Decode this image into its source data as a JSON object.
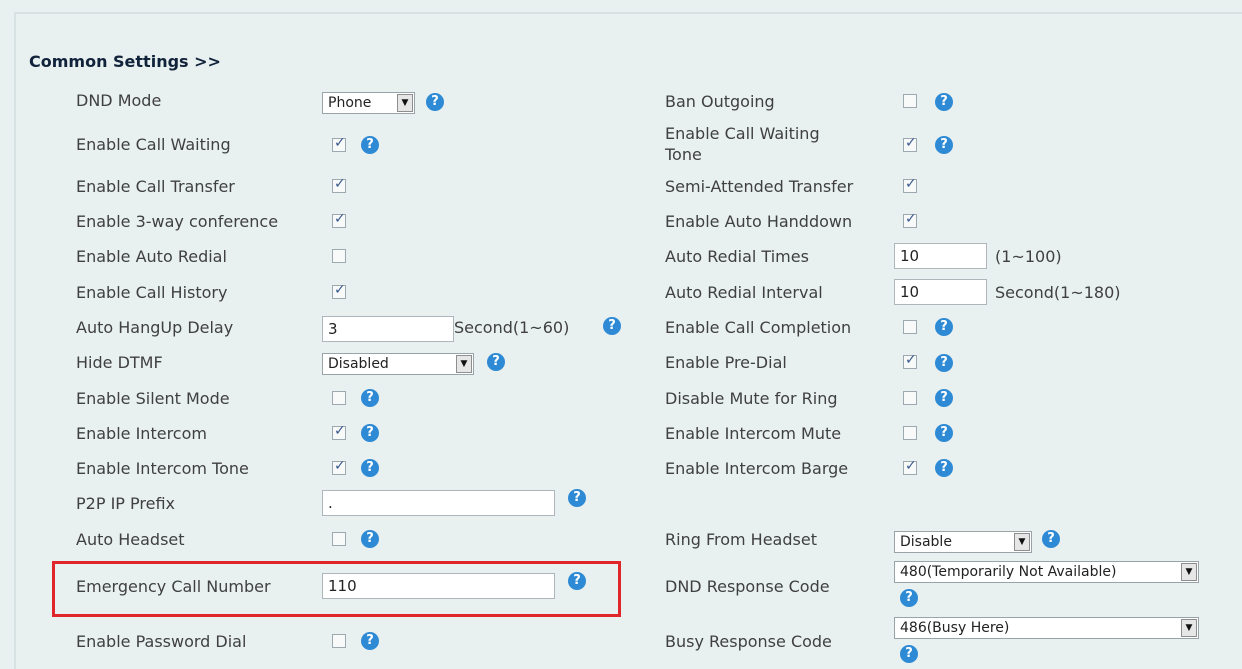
{
  "section": {
    "title": "Common Settings >>",
    "help_glyph": "?"
  },
  "select_arrow": "▼",
  "left": {
    "dnd_mode": {
      "label": "DND Mode",
      "value": "Phone"
    },
    "call_waiting": {
      "label": "Enable Call Waiting",
      "checked": true
    },
    "call_transfer": {
      "label": "Enable Call Transfer",
      "checked": true
    },
    "three_way": {
      "label": "Enable 3-way conference",
      "checked": true
    },
    "auto_redial": {
      "label": "Enable Auto Redial",
      "checked": false
    },
    "call_history": {
      "label": "Enable Call History",
      "checked": true
    },
    "auto_hangup": {
      "label": "Auto HangUp Delay",
      "value": "3",
      "unit": "Second(1~60)"
    },
    "hide_dtmf": {
      "label": "Hide DTMF",
      "value": "Disabled"
    },
    "silent_mode": {
      "label": "Enable Silent Mode",
      "checked": false
    },
    "intercom": {
      "label": "Enable Intercom",
      "checked": true
    },
    "intercom_tone": {
      "label": "Enable Intercom Tone",
      "checked": true
    },
    "p2p_prefix": {
      "label": "P2P IP Prefix",
      "value": "."
    },
    "auto_headset": {
      "label": "Auto Headset",
      "checked": false
    },
    "emergency": {
      "label": "Emergency Call Number",
      "value": "110"
    },
    "password_dial": {
      "label": "Enable Password Dial",
      "checked": false
    }
  },
  "right": {
    "ban_outgoing": {
      "label": "Ban Outgoing",
      "checked": false
    },
    "call_waiting_tone": {
      "label_line1": "Enable Call Waiting",
      "label_line2": "Tone",
      "checked": true
    },
    "semi_attended": {
      "label": "Semi-Attended Transfer",
      "checked": true
    },
    "auto_handdown": {
      "label": "Enable Auto Handdown",
      "checked": true
    },
    "redial_times": {
      "label": "Auto Redial Times",
      "value": "10",
      "unit": "(1~100)"
    },
    "redial_interval": {
      "label": "Auto Redial Interval",
      "value": "10",
      "unit": "Second(1~180)"
    },
    "call_completion": {
      "label": "Enable Call Completion",
      "checked": false
    },
    "pre_dial": {
      "label": "Enable Pre-Dial",
      "checked": true
    },
    "disable_mute_ring": {
      "label": "Disable Mute for Ring",
      "checked": false
    },
    "intercom_mute": {
      "label": "Enable Intercom Mute",
      "checked": false
    },
    "intercom_barge": {
      "label": "Enable Intercom Barge",
      "checked": true
    },
    "ring_from_headset": {
      "label": "Ring From Headset",
      "value": "Disable"
    },
    "dnd_response": {
      "label": "DND Response Code",
      "value": "480(Temporarily Not Available)"
    },
    "busy_response": {
      "label": "Busy Response Code",
      "value": "486(Busy Here)"
    }
  },
  "colors": {
    "panel": "#e8f0f0",
    "help_icon": "#2e8ad4",
    "highlight": "#e0262a",
    "title": "#10233a"
  }
}
